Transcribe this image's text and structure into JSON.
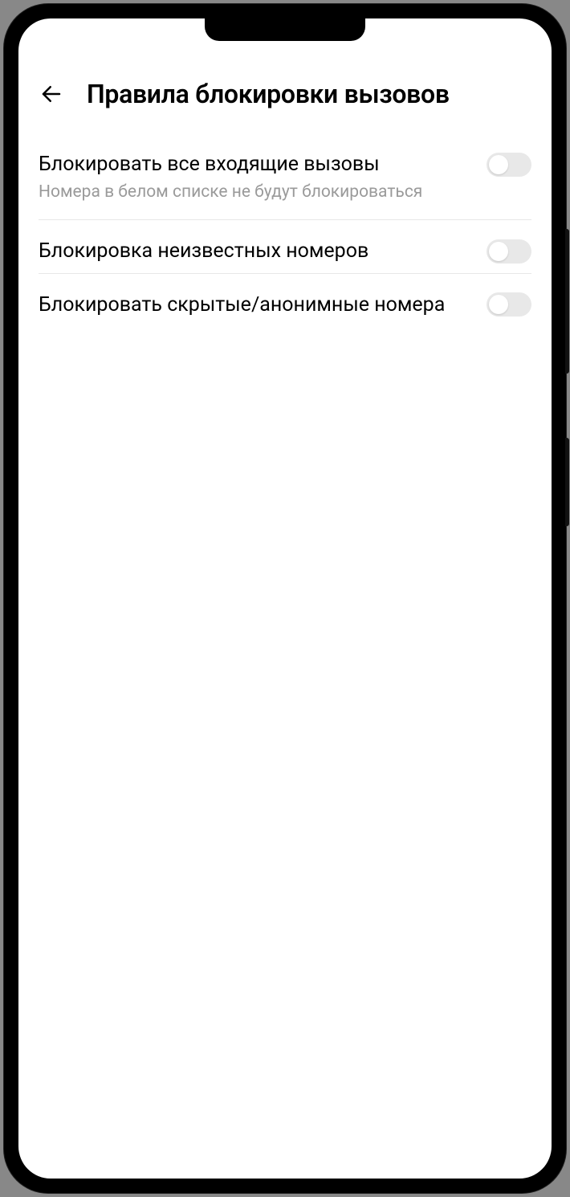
{
  "header": {
    "title": "Правила блокировки вызовов"
  },
  "settings": [
    {
      "label": "Блокировать все входящие вызовы",
      "subtitle": "Номера в белом списке не будут блокироваться",
      "enabled": false
    },
    {
      "label": "Блокировка неизвестных номеров",
      "subtitle": null,
      "enabled": false
    },
    {
      "label": "Блокировать скрытые/анонимные номера",
      "subtitle": null,
      "enabled": false
    }
  ]
}
